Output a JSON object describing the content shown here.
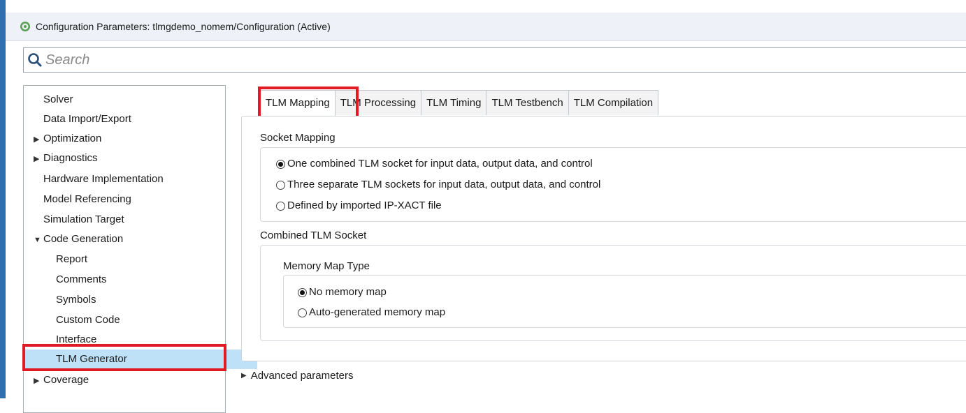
{
  "window": {
    "title": "Configuration Parameters: tlmgdemo_nomem/Configuration (Active)",
    "icon": "gear-icon",
    "accent_color": "#2f6fb0"
  },
  "search": {
    "placeholder": "Search"
  },
  "tree": {
    "items": [
      {
        "label": "Solver",
        "arrow": ""
      },
      {
        "label": "Data Import/Export",
        "arrow": ""
      },
      {
        "label": "Optimization",
        "arrow": "▶"
      },
      {
        "label": "Diagnostics",
        "arrow": "▶"
      },
      {
        "label": "Hardware Implementation",
        "arrow": ""
      },
      {
        "label": "Model Referencing",
        "arrow": ""
      },
      {
        "label": "Simulation Target",
        "arrow": ""
      },
      {
        "label": "Code Generation",
        "arrow": "▼"
      },
      {
        "label": "Report",
        "arrow": ""
      },
      {
        "label": "Comments",
        "arrow": ""
      },
      {
        "label": "Symbols",
        "arrow": ""
      },
      {
        "label": "Custom Code",
        "arrow": ""
      },
      {
        "label": "Interface",
        "arrow": ""
      },
      {
        "label": "TLM Generator",
        "arrow": "",
        "selected": true
      },
      {
        "label": "Coverage",
        "arrow": "▶"
      }
    ],
    "selected_color": "#bfe1f7"
  },
  "tabs": [
    {
      "label": "TLM Mapping",
      "active": true
    },
    {
      "label": "TLM Processing"
    },
    {
      "label": "TLM Timing"
    },
    {
      "label": "TLM Testbench"
    },
    {
      "label": "TLM Compilation"
    }
  ],
  "highlight_color": "#e01b24",
  "socket_mapping": {
    "label": "Socket Mapping",
    "options": [
      {
        "label": "One combined TLM socket for input data, output data, and control",
        "selected": true
      },
      {
        "label": "Three separate TLM sockets for input data, output data, and control",
        "selected": false
      },
      {
        "label": "Defined by imported IP-XACT file",
        "selected": false
      }
    ]
  },
  "combined_socket": {
    "label": "Combined TLM Socket",
    "memory_map": {
      "label": "Memory Map Type",
      "options": [
        {
          "label": "No memory map",
          "selected": true
        },
        {
          "label": "Auto-generated memory map",
          "selected": false
        }
      ]
    }
  },
  "advanced": {
    "label": "Advanced parameters",
    "icon": "expand-triangle-icon"
  }
}
